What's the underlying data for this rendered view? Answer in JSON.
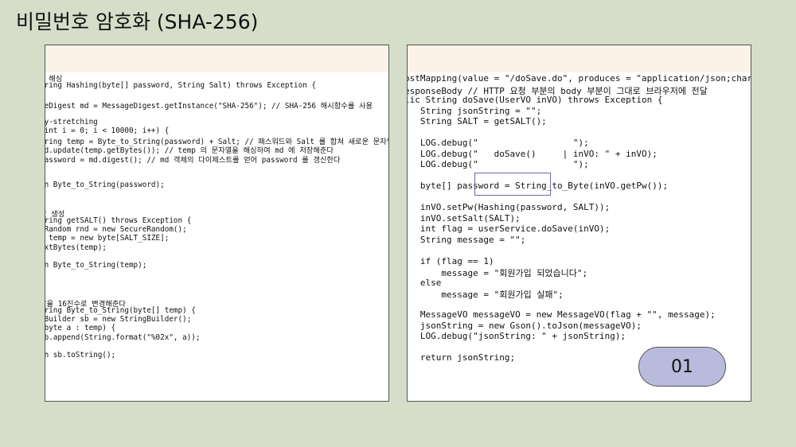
{
  "slide": {
    "title": "비밀번호 암호화 (SHA-256)",
    "badge": "01"
  },
  "left_code": [
    "  해싱",
    "tring Hashing(byte[] password, String Salt) throws Exception {",
    "",
    "geDigest md = MessageDigest.getInstance(\"SHA-256\"); // SHA-256 해시함수를 사용",
    "",
    "ey-stretching",
    "(int i = 0; i < 10000; i++) {",
    "tring temp = Byte_to_String(password) + Salt; // 패스워드와 Salt 를 합쳐 새로운 문자열 생성",
    "md.update(temp.getBytes()); // temp 의 문자열을 해싱하여 md 에 저장해준다",
    "password = md.digest(); // md 객체의 다이제스트를 얻어 password 를 갱신한다",
    "",
    "",
    "rn Byte_to_String(password);",
    "",
    "",
    "값 생성",
    "tring getSALT() throws Exception {",
    "eRandom rnd = new SecureRandom();",
    "] temp = new byte[SALT_SIZE];",
    "extBytes(temp);",
    "",
    "rn Byte_to_String(temp);",
    "",
    "",
    "",
    "값을 16진수로 변경해준다",
    "tring Byte_to_String(byte[] temp) {",
    "gBuilder sb = new StringBuilder();",
    "(byte a : temp) {",
    "sb.append(String.format(\"%02x\", a));",
    "",
    "rn sb.toString();"
  ],
  "right_code": [
    "ostMapping(value = \"/doSave.do\", produces = \"application/json;charset=",
    "esponseBody // HTTP 요청 부분의 body 부분이 그대로 브라우저에 전달",
    "lic String doSave(UserVO inVO) throws Exception {",
    "   String jsonString = \"\";",
    "   String SALT = getSALT();",
    "",
    "   LOG.debug(\"                  \");",
    "   LOG.debug(\"   doSave()     | inVO: \" + inVO);",
    "   LOG.debug(\"                  \");",
    "",
    "   byte[] password = String_to_Byte(inVO.getPw());",
    "",
    "   inVO.setPw(Hashing(password, SALT));",
    "   inVO.setSalt(SALT);",
    "   int flag = userService.doSave(inVO);",
    "   String message = \"\";",
    "",
    "   if (flag == 1)",
    "       message = \"회원가입 되었습니다\";",
    "   else",
    "       message = \"회원가입 실패\";",
    "",
    "   MessageVO messageVO = new MessageVO(flag + \"\", message);",
    "   jsonString = new Gson().toJson(messageVO);",
    "   LOG.debug(\"jsonString: \" + jsonString);",
    "",
    "   return jsonString;"
  ]
}
